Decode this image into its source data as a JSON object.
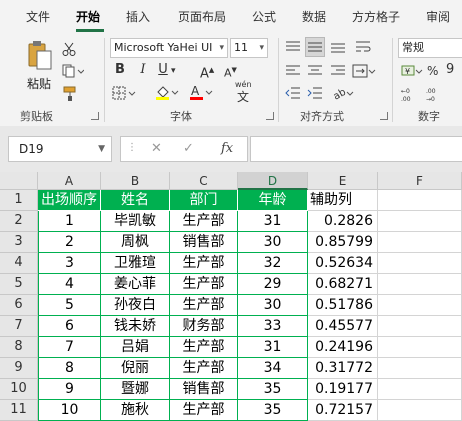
{
  "menu": {
    "tabs": [
      {
        "label": "文件",
        "active": false
      },
      {
        "label": "开始",
        "active": true
      },
      {
        "label": "插入",
        "active": false
      },
      {
        "label": "页面布局",
        "active": false
      },
      {
        "label": "公式",
        "active": false
      },
      {
        "label": "数据",
        "active": false
      },
      {
        "label": "方方格子",
        "active": false
      },
      {
        "label": "审阅",
        "active": false
      }
    ]
  },
  "ribbon": {
    "clipboard": {
      "paste_label": "粘贴",
      "group_label": "剪贴板"
    },
    "font": {
      "font_name": "Microsoft YaHei UI",
      "font_size": "11",
      "bold": "B",
      "italic": "I",
      "underline": "U",
      "grow": "A",
      "shrink": "A",
      "phonetic_top": "wén",
      "phonetic_bottom": "文",
      "group_label": "字体"
    },
    "alignment": {
      "group_label": "对齐方式"
    },
    "number": {
      "format": "常规",
      "group_label": "数字"
    },
    "accent_color": "#217346",
    "fill_color": "#ffff00",
    "font_color": "#ff0000"
  },
  "formula_bar": {
    "name_box": "D19",
    "fx_label": "fx",
    "cancel": "✕",
    "confirm": "✓",
    "content": ""
  },
  "sheet": {
    "columns": [
      "A",
      "B",
      "C",
      "D",
      "E",
      "F"
    ],
    "selected_column": "D",
    "header_fill": "#00b050",
    "header": [
      "出场顺序",
      "姓名",
      "部门",
      "年龄",
      "辅助列"
    ],
    "rows": [
      {
        "n": "2",
        "cells": [
          "1",
          "毕凯敏",
          "生产部",
          "31",
          "0.2826"
        ]
      },
      {
        "n": "3",
        "cells": [
          "2",
          "周枫",
          "销售部",
          "30",
          "0.85799"
        ]
      },
      {
        "n": "4",
        "cells": [
          "3",
          "卫雅瑄",
          "生产部",
          "32",
          "0.52634"
        ]
      },
      {
        "n": "5",
        "cells": [
          "4",
          "姜心菲",
          "生产部",
          "29",
          "0.68271"
        ]
      },
      {
        "n": "6",
        "cells": [
          "5",
          "孙夜白",
          "生产部",
          "30",
          "0.51786"
        ]
      },
      {
        "n": "7",
        "cells": [
          "6",
          "钱未娇",
          "财务部",
          "33",
          "0.45577"
        ]
      },
      {
        "n": "8",
        "cells": [
          "7",
          "吕娟",
          "生产部",
          "31",
          "0.24196"
        ]
      },
      {
        "n": "9",
        "cells": [
          "8",
          "倪丽",
          "生产部",
          "34",
          "0.31772"
        ]
      },
      {
        "n": "10",
        "cells": [
          "9",
          "暨娜",
          "销售部",
          "35",
          "0.19177"
        ]
      },
      {
        "n": "11",
        "cells": [
          "10",
          "施秋",
          "生产部",
          "35",
          "0.72157"
        ]
      }
    ]
  }
}
